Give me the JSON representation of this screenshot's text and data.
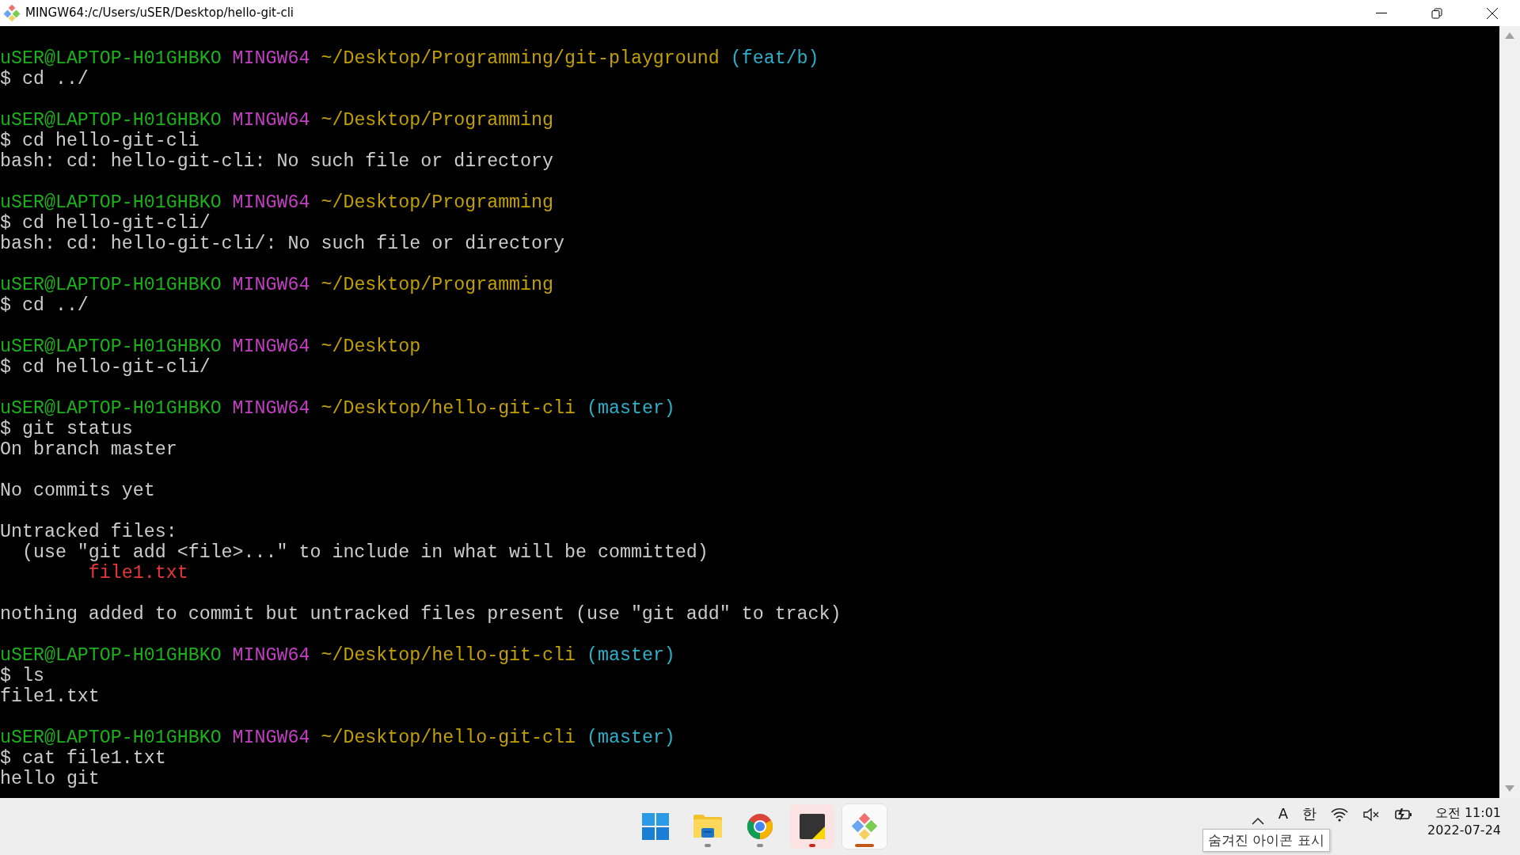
{
  "window": {
    "title": "MINGW64:/c/Users/uSER/Desktop/hello-git-cli"
  },
  "terminal": {
    "lines": [
      {
        "kind": "prompt",
        "user": "uSER@LAPTOP-H01GHBKO",
        "host": "MINGW64",
        "path": "~/Desktop/Programming/git-playground",
        "branch": "(feat/b)"
      },
      {
        "kind": "text",
        "text": "$ cd ../"
      },
      {
        "kind": "blank"
      },
      {
        "kind": "prompt",
        "user": "uSER@LAPTOP-H01GHBKO",
        "host": "MINGW64",
        "path": "~/Desktop/Programming"
      },
      {
        "kind": "text",
        "text": "$ cd hello-git-cli"
      },
      {
        "kind": "text",
        "text": "bash: cd: hello-git-cli: No such file or directory"
      },
      {
        "kind": "blank"
      },
      {
        "kind": "prompt",
        "user": "uSER@LAPTOP-H01GHBKO",
        "host": "MINGW64",
        "path": "~/Desktop/Programming"
      },
      {
        "kind": "text",
        "text": "$ cd hello-git-cli/"
      },
      {
        "kind": "text",
        "text": "bash: cd: hello-git-cli/: No such file or directory"
      },
      {
        "kind": "blank"
      },
      {
        "kind": "prompt",
        "user": "uSER@LAPTOP-H01GHBKO",
        "host": "MINGW64",
        "path": "~/Desktop/Programming"
      },
      {
        "kind": "text",
        "text": "$ cd ../"
      },
      {
        "kind": "blank"
      },
      {
        "kind": "prompt",
        "user": "uSER@LAPTOP-H01GHBKO",
        "host": "MINGW64",
        "path": "~/Desktop"
      },
      {
        "kind": "text",
        "text": "$ cd hello-git-cli/"
      },
      {
        "kind": "blank"
      },
      {
        "kind": "prompt",
        "user": "uSER@LAPTOP-H01GHBKO",
        "host": "MINGW64",
        "path": "~/Desktop/hello-git-cli",
        "branch": "(master)"
      },
      {
        "kind": "text",
        "text": "$ git status"
      },
      {
        "kind": "text",
        "text": "On branch master"
      },
      {
        "kind": "blank"
      },
      {
        "kind": "text",
        "text": "No commits yet"
      },
      {
        "kind": "blank"
      },
      {
        "kind": "text",
        "text": "Untracked files:"
      },
      {
        "kind": "text",
        "text": "  (use \"git add <file>...\" to include in what will be committed)"
      },
      {
        "kind": "untracked",
        "text": "        file1.txt"
      },
      {
        "kind": "blank"
      },
      {
        "kind": "text",
        "text": "nothing added to commit but untracked files present (use \"git add\" to track)"
      },
      {
        "kind": "blank"
      },
      {
        "kind": "prompt",
        "user": "uSER@LAPTOP-H01GHBKO",
        "host": "MINGW64",
        "path": "~/Desktop/hello-git-cli",
        "branch": "(master)"
      },
      {
        "kind": "text",
        "text": "$ ls"
      },
      {
        "kind": "text",
        "text": "file1.txt"
      },
      {
        "kind": "blank"
      },
      {
        "kind": "prompt",
        "user": "uSER@LAPTOP-H01GHBKO",
        "host": "MINGW64",
        "path": "~/Desktop/hello-git-cli",
        "branch": "(master)"
      },
      {
        "kind": "text",
        "text": "$ cat file1.txt"
      },
      {
        "kind": "text",
        "text": "hello git"
      }
    ]
  },
  "taskbar": {
    "apps": [
      {
        "kind": "start",
        "running": false,
        "flashing": false,
        "active": false
      },
      {
        "kind": "folder",
        "running": true,
        "flashing": false,
        "active": false
      },
      {
        "kind": "browser",
        "running": true,
        "flashing": false,
        "active": false
      },
      {
        "kind": "note",
        "running": true,
        "flashing": true,
        "active": false
      },
      {
        "kind": "gitbash",
        "running": true,
        "flashing": false,
        "active": true
      }
    ],
    "tray": {
      "input_mode": "A",
      "ime": "한",
      "tooltip": "숨겨진 아이콘 표시",
      "time": "오전 11:01",
      "date": "2022-07-24"
    }
  }
}
